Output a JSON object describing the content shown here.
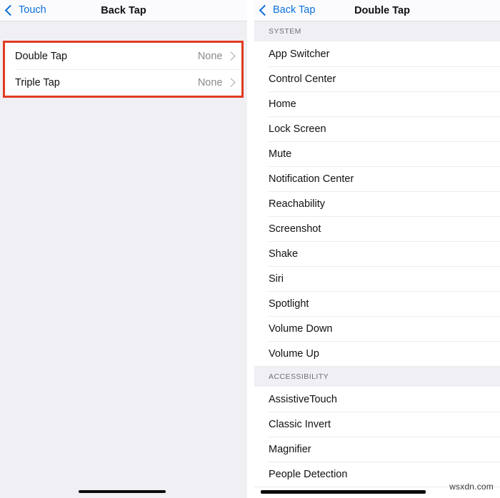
{
  "left_screen": {
    "nav": {
      "back_label": "Touch",
      "title": "Back Tap"
    },
    "rows": [
      {
        "label": "Double Tap",
        "value": "None"
      },
      {
        "label": "Triple Tap",
        "value": "None"
      }
    ],
    "highlight_color": "#e03c22"
  },
  "right_screen": {
    "nav": {
      "back_label": "Back Tap",
      "title": "Double Tap"
    },
    "sections": [
      {
        "header": "SYSTEM",
        "items": [
          "App Switcher",
          "Control Center",
          "Home",
          "Lock Screen",
          "Mute",
          "Notification Center",
          "Reachability",
          "Screenshot",
          "Shake",
          "Siri",
          "Spotlight",
          "Volume Down",
          "Volume Up"
        ]
      },
      {
        "header": "ACCESSIBILITY",
        "items": [
          "AssistiveTouch",
          "Classic Invert",
          "Magnifier",
          "People Detection"
        ]
      }
    ]
  },
  "watermark": "wsxdn.com",
  "accent_blue": "#0a6fd8"
}
